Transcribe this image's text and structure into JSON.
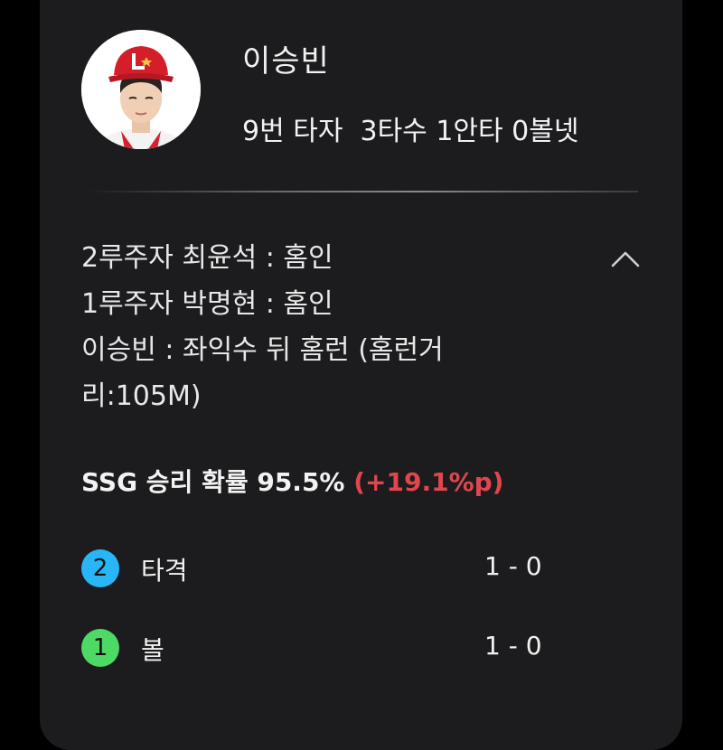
{
  "player": {
    "name": "이승빈",
    "stats": "9번 타자  3타수 1안타 0볼넷",
    "avatar_icon": "player-photo"
  },
  "play": {
    "lines": [
      "2루주자 최윤석 : 홈인",
      "1루주자 박명현 : 홈인",
      "이승빈 : 좌익수 뒤 홈런 (홈런거",
      "리:105M)"
    ],
    "toggle_icon": "chevron-up-icon"
  },
  "win_probability": {
    "text": "SSG 승리 확률 95.5% ",
    "delta": "(+19.1%p)",
    "delta_color": "#e0474c"
  },
  "pitches": [
    {
      "number": "2",
      "label": "타격",
      "count": "1 - 0",
      "color": "#29b6f6"
    },
    {
      "number": "1",
      "label": "볼",
      "count": "1 - 0",
      "color": "#4cd964"
    }
  ]
}
